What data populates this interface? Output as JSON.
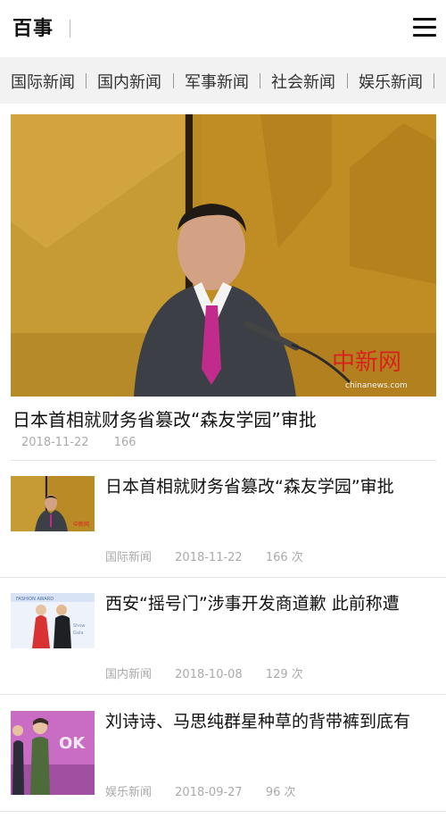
{
  "header": {
    "logo": "百事",
    "menu_icon": "hamburger-menu-icon"
  },
  "nav": {
    "items": [
      "国际新闻",
      "国内新闻",
      "军事新闻",
      "社会新闻",
      "娱乐新闻"
    ]
  },
  "hero": {
    "title": "日本首相就财务省篡改“森友学园”审批",
    "date": "2018-11-22",
    "views": "166",
    "watermark": "中新网",
    "watermark_sub": "chinanews.com"
  },
  "news": [
    {
      "title": "日本首相就财务省篡改“森友学园”审批",
      "category": "国际新闻",
      "date": "2018-11-22",
      "views": "166 次"
    },
    {
      "title": "西安“摇号门”涉事开发商道歉 此前称遭",
      "category": "国内新闻",
      "date": "2018-10-08",
      "views": "129 次"
    },
    {
      "title": "刘诗诗、马思纯群星种草的背带裤到底有",
      "category": "娱乐新闻",
      "date": "2018-09-27",
      "views": "96 次"
    }
  ],
  "colors": {
    "hero_background": "#c79b33",
    "nav_background": "#f2f2f2",
    "meta_text": "#aaaaaa"
  }
}
